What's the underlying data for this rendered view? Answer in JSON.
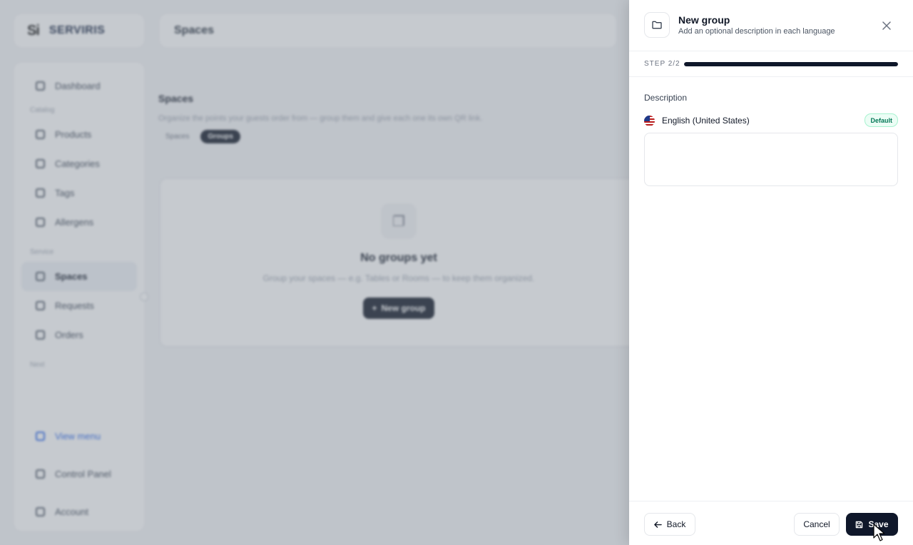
{
  "brand": {
    "mark": "Si",
    "name": "SERVIRIS"
  },
  "topbar": {
    "title": "Spaces"
  },
  "sidebar": {
    "items": [
      {
        "label": "Dashboard",
        "icon": "dashboard-icon"
      },
      {
        "section": "Catalog"
      },
      {
        "label": "Products",
        "icon": "box-icon"
      },
      {
        "label": "Categories",
        "icon": "grid-icon"
      },
      {
        "label": "Tags",
        "icon": "tag-icon"
      },
      {
        "label": "Allergens",
        "icon": "allergen-icon"
      },
      {
        "section": "Service"
      },
      {
        "label": "Spaces",
        "icon": "location-icon",
        "active": true
      },
      {
        "label": "Requests",
        "icon": "bell-icon"
      },
      {
        "label": "Orders",
        "icon": "receipt-icon"
      },
      {
        "section": "Next"
      }
    ],
    "bottom": [
      {
        "label": "View menu",
        "icon": "external-link-icon"
      },
      {
        "label": "Control Panel",
        "icon": "settings-icon"
      },
      {
        "label": "Account",
        "icon": "user-icon"
      }
    ]
  },
  "main": {
    "title": "Spaces",
    "description": "Organize the points your guests order from — group them and give each one its own QR link.",
    "tabs": [
      {
        "label": "Spaces",
        "active": false
      },
      {
        "label": "Groups",
        "active": true
      }
    ],
    "empty": {
      "title": "No groups yet",
      "description": "Group your spaces — e.g. Tables or Rooms — to keep them organized.",
      "button": "New group"
    }
  },
  "drawer": {
    "title": "New group",
    "subtitle": "Add an optional description in each language",
    "step_label": "STEP 2/2",
    "step_progress": 1.0,
    "description_label": "Description",
    "language": "English (United States)",
    "default_badge": "Default",
    "description_value": "",
    "back_label": "Back",
    "cancel_label": "Cancel",
    "save_label": "Save"
  },
  "colors": {
    "primary": "#0f172a",
    "accent": "#2563eb",
    "badge_green": "#047857"
  }
}
